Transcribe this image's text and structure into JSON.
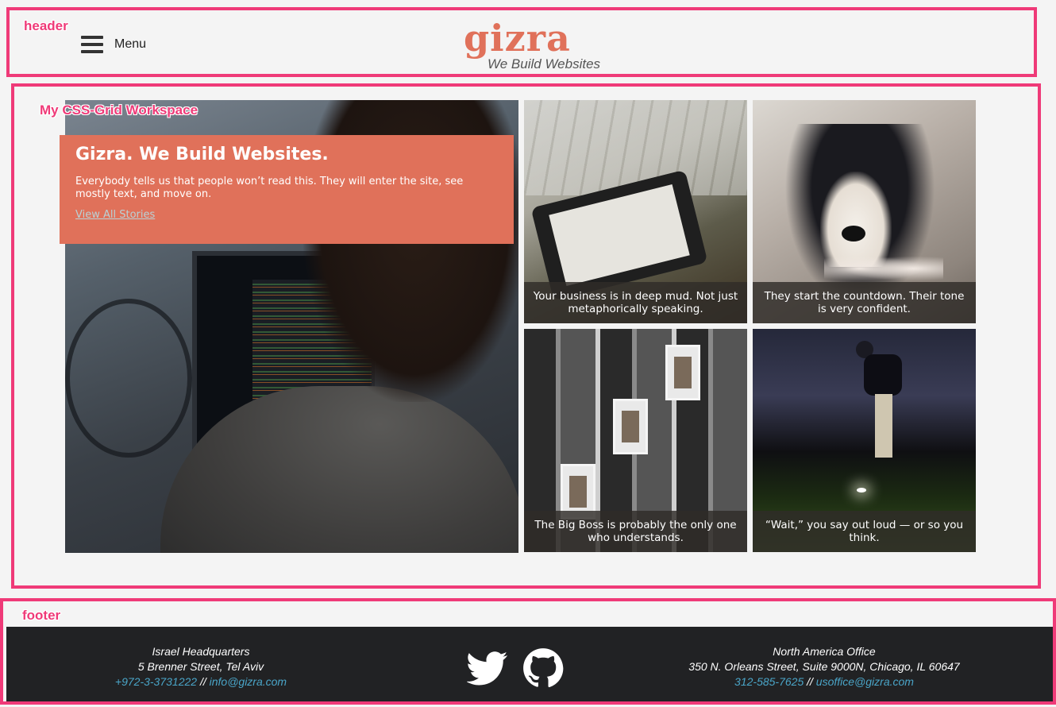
{
  "annotations": {
    "header": "header",
    "workspace": "My CSS-Grid Workspace",
    "footer": "footer"
  },
  "header": {
    "menu_label": "Menu",
    "logo_word": "gizra",
    "logo_tagline": "We Build Websites",
    "brand_color": "#e0715a"
  },
  "main": {
    "intro": {
      "title": "Gizra. We Build Websites.",
      "text": "Everybody tells us that people won’t read this. They will enter the site, see mostly text, and move on.",
      "link": "View All Stories"
    },
    "tiles": [
      {
        "caption": "Your business is in deep mud. Not just metaphorically speaking.",
        "image": "laptop-phone-photo"
      },
      {
        "caption": "They start the countdown. Their tone is very confident.",
        "image": "puppy-photo"
      },
      {
        "caption": "The Big Boss is probably the only one who understands.",
        "image": "elevators-photo"
      },
      {
        "caption": "“Wait,” you say out loud — or so you think.",
        "image": "golfer-photo"
      }
    ]
  },
  "footer": {
    "israel": {
      "title": "Israel Headquarters",
      "address": "5 Brenner Street, Tel Aviv",
      "phone": "+972-3-3731222",
      "separator": "//",
      "email": "info@gizra.com"
    },
    "north_america": {
      "title": "North America Office",
      "address": "350 N. Orleans Street, Suite 9000N, Chicago, IL 60647",
      "phone": "312-585-7625",
      "separator": "//",
      "email": "usoffice@gizra.com"
    },
    "social": [
      "twitter-icon",
      "github-icon"
    ],
    "link_color": "#4aa5c8"
  }
}
